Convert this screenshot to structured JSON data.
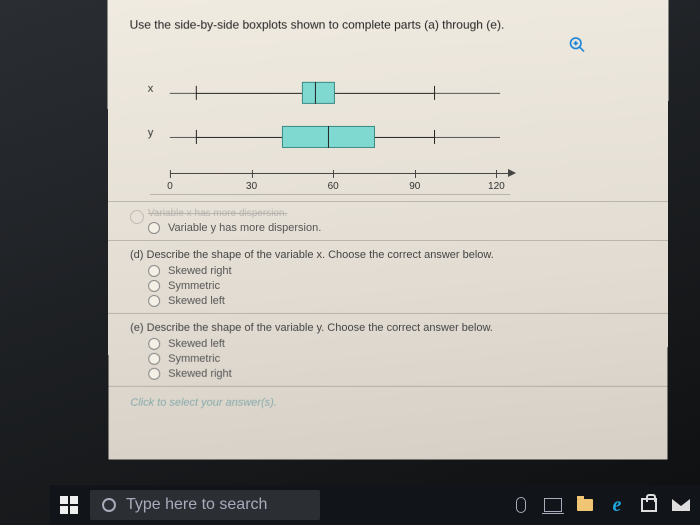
{
  "instruction": "Use the side-by-side boxplots shown to complete parts (a) through (e).",
  "chart_data": {
    "type": "boxplot",
    "xlim": [
      0,
      125
    ],
    "ticks": [
      0,
      30,
      60,
      90,
      120
    ],
    "series": [
      {
        "name": "x",
        "min": 10,
        "q1": 50,
        "median": 55,
        "q3": 62,
        "max": 100
      },
      {
        "name": "y",
        "min": 10,
        "q1": 42,
        "median": 60,
        "q3": 78,
        "max": 100
      }
    ]
  },
  "truncated_option": "Variable x has more dispersion.",
  "option_y_dispersion": "Variable y has more dispersion.",
  "question_d": "(d) Describe the shape of the variable x. Choose the correct answer below.",
  "options_d": {
    "a": "Skewed right",
    "b": "Symmetric",
    "c": "Skewed left"
  },
  "question_e": "(e) Describe the shape of the variable y. Choose the correct answer below.",
  "options_e": {
    "a": "Skewed left",
    "b": "Symmetric",
    "c": "Skewed right"
  },
  "hint": "Click to select your answer(s).",
  "taskbar": {
    "search_placeholder": "Type here to search"
  }
}
